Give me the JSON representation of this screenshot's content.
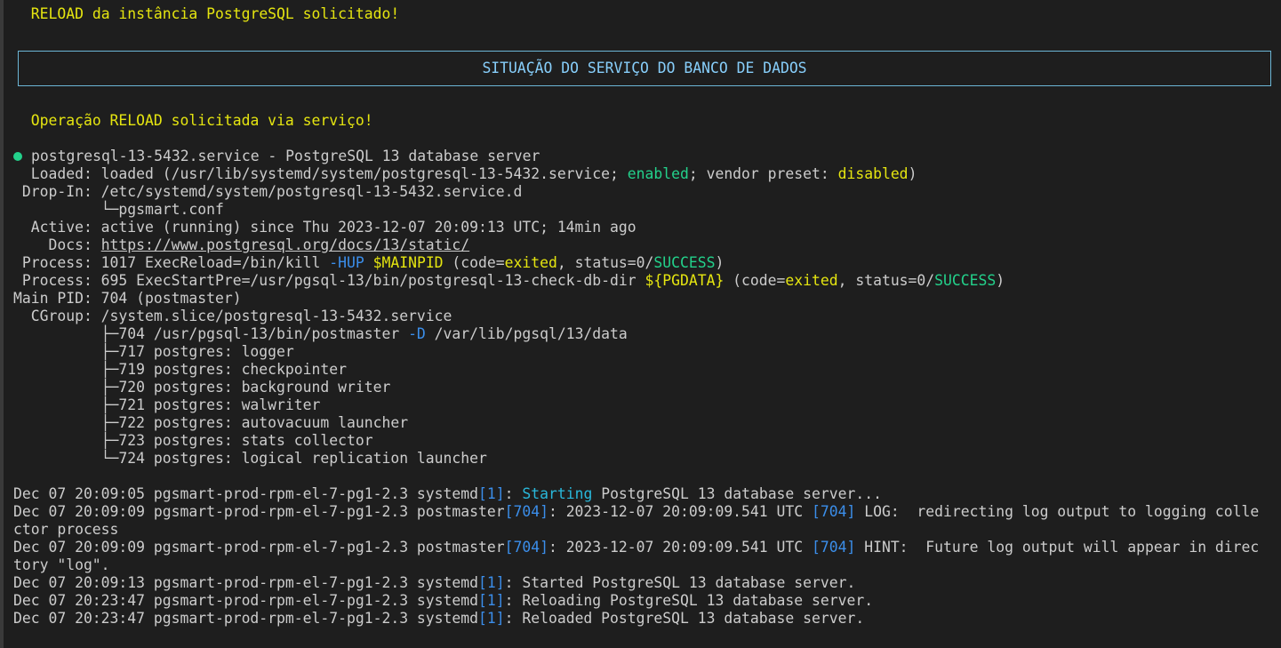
{
  "messages": {
    "reload_requested": "RELOAD da instância PostgreSQL solicitado!",
    "banner": "SITUAÇÃO DO SERVIÇO DO BANCO DE DADOS",
    "operation": "Operação RELOAD solicitada via serviço!"
  },
  "status": {
    "unit": "postgresql-13-5432.service - PostgreSQL 13 database server",
    "loaded_prefix": "  Loaded: loaded (/usr/lib/systemd/system/postgresql-13-5432.service; ",
    "loaded_enabled": "enabled",
    "loaded_mid": "; vendor preset: ",
    "loaded_disabled": "disabled",
    "loaded_suffix": ")",
    "dropin": " Drop-In: /etc/systemd/system/postgresql-13-5432.service.d",
    "dropin_file": "          └─pgsmart.conf",
    "active": "  Active: active (running) since Thu 2023-12-07 20:09:13 UTC; 14min ago",
    "docs_prefix": "    Docs: ",
    "docs_url": "https://www.postgresql.org/docs/13/static/",
    "process1_prefix": " Process: 1017 ExecReload=/bin/kill ",
    "process1_flag": "-HUP",
    "process1_space": " ",
    "process1_var": "$MAINPID",
    "process1_code": " (code=",
    "process1_exited": "exited",
    "process1_status": ", status=0/",
    "process1_success": "SUCCESS",
    "process1_end": ")",
    "process2_prefix": " Process: 695 ExecStartPre=/usr/pgsql-13/bin/postgresql-13-check-db-dir ",
    "process2_var": "${PGDATA}",
    "process2_code": " (code=",
    "process2_exited": "exited",
    "process2_status": ", status=0/",
    "process2_success": "SUCCESS",
    "process2_end": ")",
    "mainpid": "Main PID: 704 (postmaster)",
    "cgroup": "  CGroup: /system.slice/postgresql-13-5432.service",
    "tree0_prefix": "          ├─704 /usr/pgsql-13/bin/postmaster ",
    "tree0_flag": "-D",
    "tree0_suffix": " /var/lib/pgsql/13/data",
    "tree": [
      "          ├─717 postgres: logger",
      "          ├─719 postgres: checkpointer",
      "          ├─720 postgres: background writer",
      "          ├─721 postgres: walwriter",
      "          ├─722 postgres: autovacuum launcher",
      "          ├─723 postgres: stats collector",
      "          └─724 postgres: logical replication launcher"
    ]
  },
  "logs": {
    "l1_prefix": "Dec 07 20:09:05 pgsmart-prod-rpm-el-7-pg1-2.3 systemd",
    "l1_pid": "[1]",
    "l1_colon": ": ",
    "l1_starting": "Starting",
    "l1_rest": " PostgreSQL 13 database server...",
    "l2_prefix": "Dec 07 20:09:09 pgsmart-prod-rpm-el-7-pg1-2.3 postmaster",
    "l2_pid": "[704]",
    "l2_mid": ": 2023-12-07 20:09:09.541 UTC ",
    "l2_pid2": "[704]",
    "l2_rest": " LOG:  redirecting log output to logging colle",
    "l2_wrap": "ctor process",
    "l3_prefix": "Dec 07 20:09:09 pgsmart-prod-rpm-el-7-pg1-2.3 postmaster",
    "l3_pid": "[704]",
    "l3_mid": ": 2023-12-07 20:09:09.541 UTC ",
    "l3_pid2": "[704]",
    "l3_rest": " HINT:  Future log output will appear in direc",
    "l3_wrap": "tory \"log\".",
    "l4_prefix": "Dec 07 20:09:13 pgsmart-prod-rpm-el-7-pg1-2.3 systemd",
    "l4_pid": "[1]",
    "l4_rest": ": Started PostgreSQL 13 database server.",
    "l5_prefix": "Dec 07 20:23:47 pgsmart-prod-rpm-el-7-pg1-2.3 systemd",
    "l5_pid": "[1]",
    "l5_rest": ": Reloading PostgreSQL 13 database server.",
    "l6_prefix": "Dec 07 20:23:47 pgsmart-prod-rpm-el-7-pg1-2.3 systemd",
    "l6_pid": "[1]",
    "l6_rest": ": Reloaded PostgreSQL 13 database server."
  }
}
